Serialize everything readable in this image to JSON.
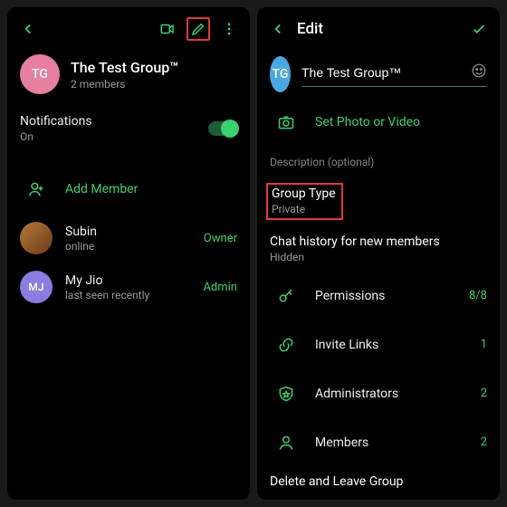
{
  "left": {
    "header": {
      "name": "The Test Group™",
      "members": "2 members",
      "avatar": "TG"
    },
    "notifications": {
      "label": "Notifications",
      "state": "On"
    },
    "addMember": "Add Member",
    "members": [
      {
        "avatar": "",
        "photo": true,
        "name": "Subin",
        "sub": "online",
        "subGreen": true,
        "role": "Owner"
      },
      {
        "avatar": "MJ",
        "photo": false,
        "name": "My Jio",
        "sub": "last seen recently",
        "subGreen": false,
        "role": "Admin"
      }
    ]
  },
  "right": {
    "title": "Edit",
    "avatar": "TG",
    "groupName": "The Test Group™",
    "setPhoto": "Set Photo or Video",
    "descLabel": "Description (optional)",
    "groupType": {
      "label": "Group Type",
      "value": "Private"
    },
    "chatHistory": {
      "label": "Chat history for new members",
      "value": "Hidden"
    },
    "items": [
      {
        "icon": "key",
        "label": "Permissions",
        "value": "8/8"
      },
      {
        "icon": "link",
        "label": "Invite Links",
        "value": "1"
      },
      {
        "icon": "shield",
        "label": "Administrators",
        "value": "2"
      },
      {
        "icon": "user",
        "label": "Members",
        "value": "2"
      }
    ],
    "delete": "Delete and Leave Group"
  }
}
